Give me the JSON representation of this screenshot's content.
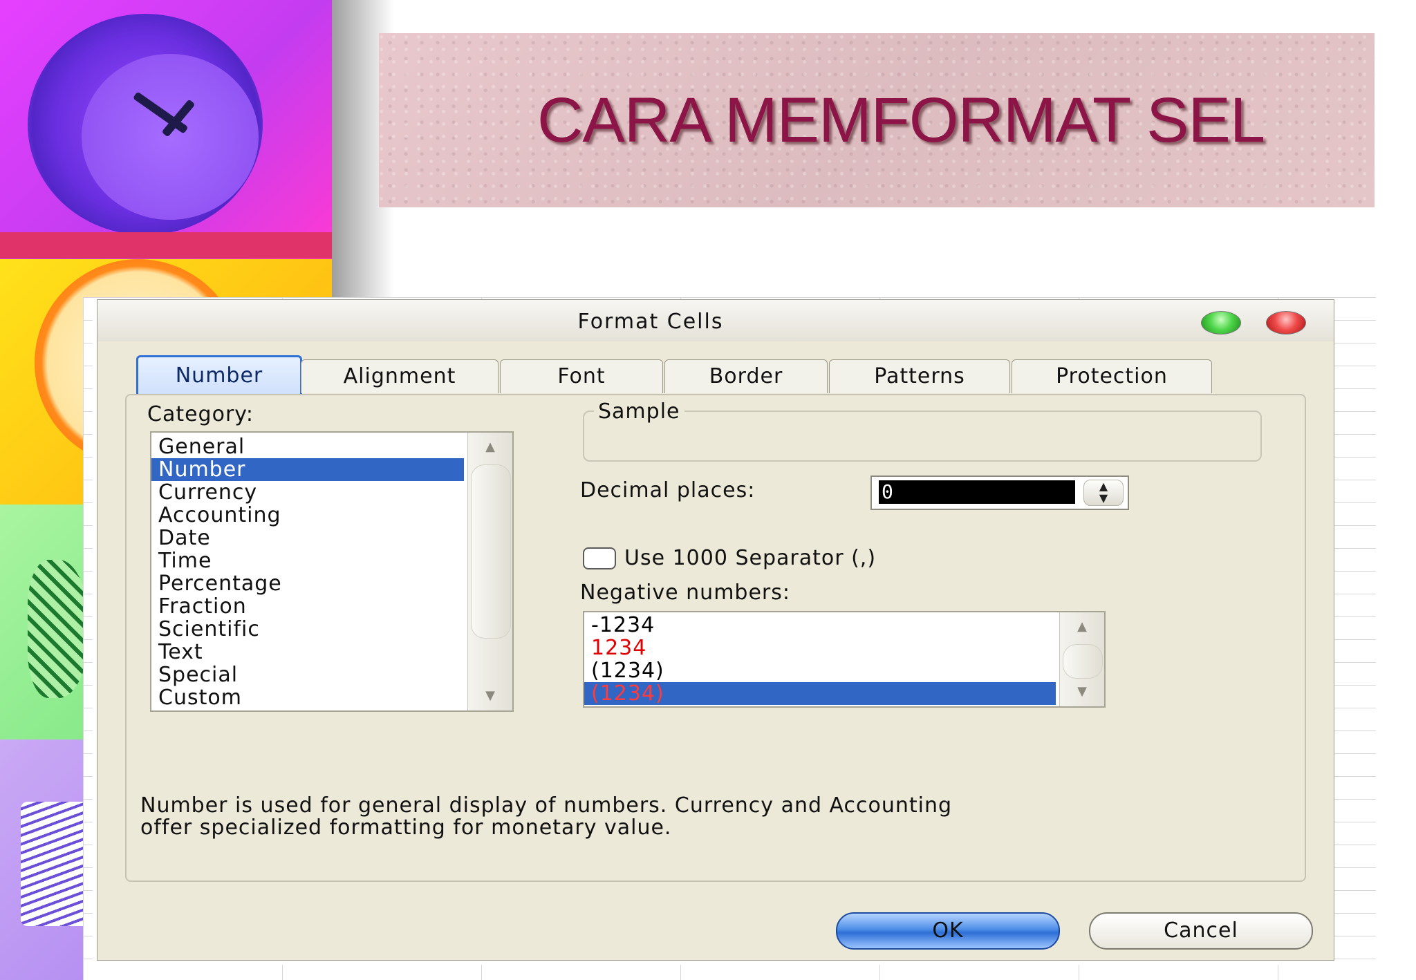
{
  "slide": {
    "title": "CARA MEMFORMAT SEL"
  },
  "dialog": {
    "title": "Format Cells",
    "tabs": [
      {
        "label": "Number",
        "active": true
      },
      {
        "label": "Alignment"
      },
      {
        "label": "Font"
      },
      {
        "label": "Border"
      },
      {
        "label": "Patterns"
      },
      {
        "label": "Protection"
      }
    ],
    "category_label": "Category:",
    "categories": [
      "General",
      "Number",
      "Currency",
      "Accounting",
      "Date",
      "Time",
      "Percentage",
      "Fraction",
      "Scientific",
      "Text",
      "Special",
      "Custom"
    ],
    "selected_category": "Number",
    "sample_label": "Sample",
    "decimal_places_label": "Decimal places:",
    "decimal_places_value": "0",
    "separator_label": "Use 1000 Separator (,)",
    "separator_checked": false,
    "negative_numbers_label": "Negative numbers:",
    "negative_numbers": [
      {
        "text": "-1234",
        "color": "#000000"
      },
      {
        "text": "1234",
        "color": "#e00000"
      },
      {
        "text": "(1234)",
        "color": "#000000"
      },
      {
        "text": "(1234)",
        "color": "#e00000",
        "selected": true
      }
    ],
    "description_line1": "Number is used for general display of numbers.  Currency and Accounting",
    "description_line2": "offer specialized formatting for monetary value.",
    "ok_label": "OK",
    "cancel_label": "Cancel"
  },
  "colors": {
    "title_text": "#8c1446",
    "selection_blue": "#3166c4",
    "dialog_bg": "#ece9d8"
  }
}
